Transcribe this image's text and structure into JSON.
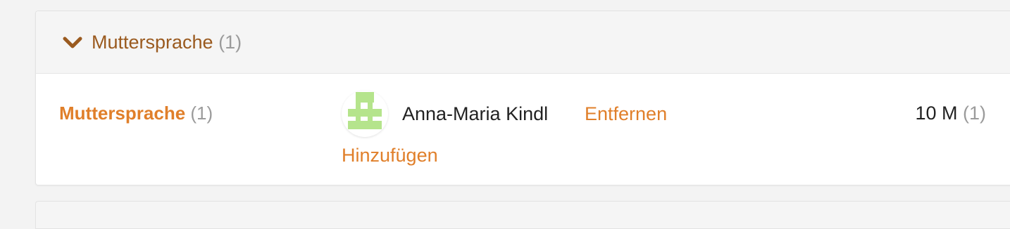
{
  "section": {
    "title": "Muttersprache",
    "count": "(1)",
    "chevron_icon": "chevron-down-icon",
    "title_color": "#9a5a1f"
  },
  "row": {
    "label": "Muttersprache",
    "count": "(1)",
    "avatar_icon": "user-avatar-icon",
    "avatar_color": "#b5e48c",
    "person_name": "Anna-Maria Kindl",
    "remove_label": "Entfernen",
    "add_label": "Hinzufügen",
    "size_value": "10 M",
    "size_count": "(1)"
  },
  "colors": {
    "accent": "#e07f2a",
    "muted": "#9b9b9b",
    "text": "#222222"
  }
}
